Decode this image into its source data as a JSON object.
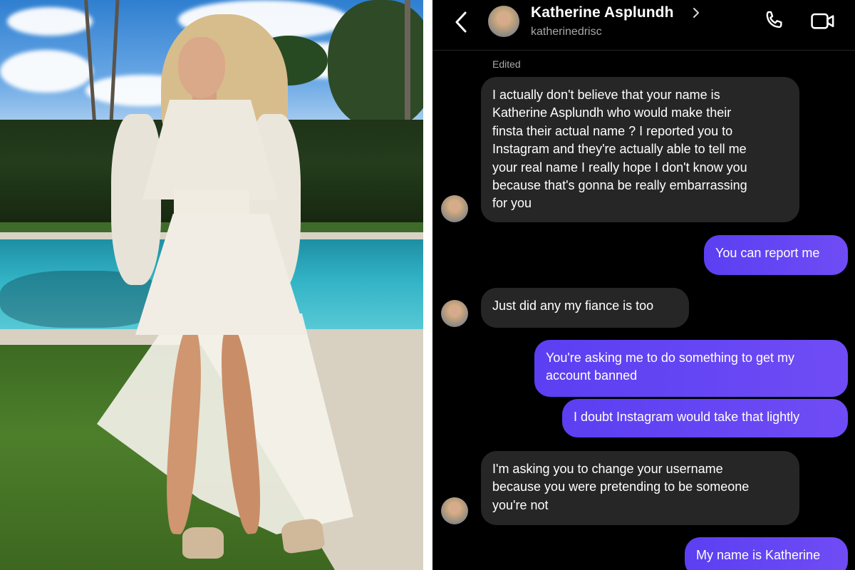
{
  "conversation": {
    "contact_name": "Katherine Asplundh",
    "username": "katherinedrisc",
    "edited_label": "Edited",
    "messages": [
      {
        "direction": "in",
        "text": "I actually don't believe that your name is\nKatherine Asplundh who would make their\nfinsta their actual name ? I reported you to\nInstagram and they're actually able to tell me\nyour real name I really hope I don't know you\nbecause that's gonna be really embarrassing\nfor you"
      },
      {
        "direction": "out",
        "text": "You can report me"
      },
      {
        "direction": "in",
        "text": "Just did any my fiance is too"
      },
      {
        "direction": "out",
        "text": "You're asking me to do something to get my\naccount banned"
      },
      {
        "direction": "out",
        "text": "I doubt Instagram would take that lightly"
      },
      {
        "direction": "in",
        "text": "I'm asking you to change your username\nbecause you were pretending to be someone\nyou're not"
      },
      {
        "direction": "out",
        "text": "My name is Katherine"
      }
    ]
  },
  "icons": {
    "back": "chevron-left-icon",
    "profile_chevron": "chevron-right-icon",
    "call": "phone-icon",
    "video": "video-camera-icon"
  },
  "colors": {
    "background": "#000000",
    "incoming_bubble": "#262626",
    "outgoing_bubble": "#6a48f4",
    "secondary_text": "#a8a8a8"
  }
}
